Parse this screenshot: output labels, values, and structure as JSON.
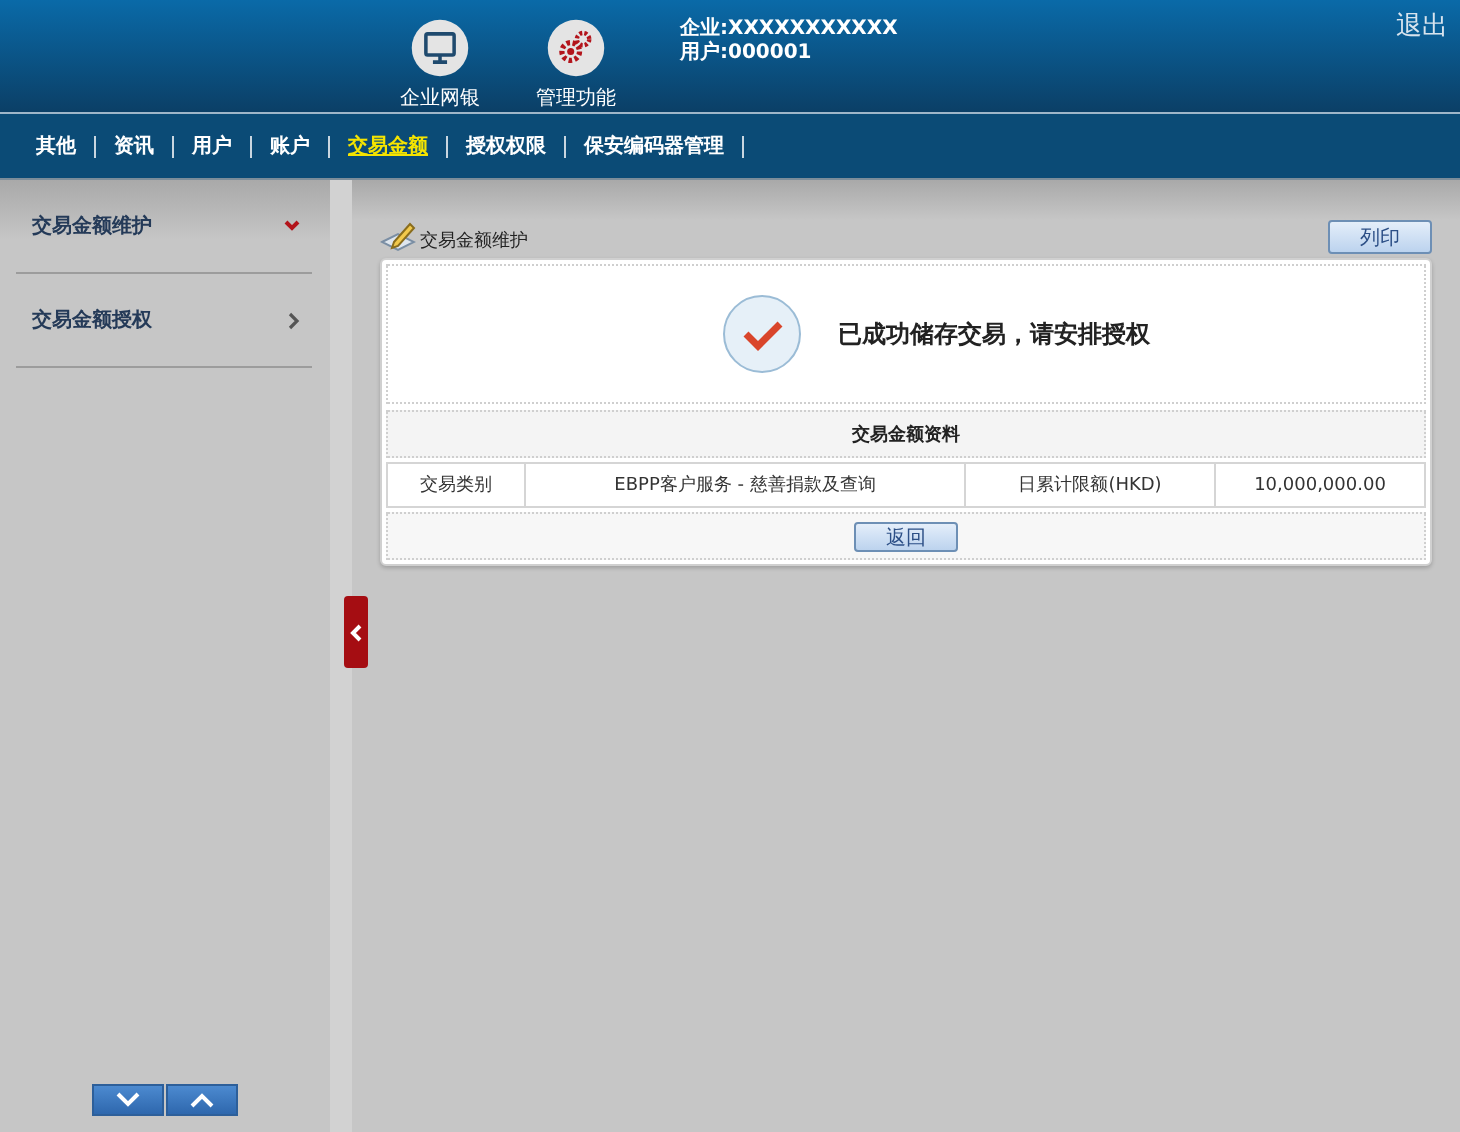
{
  "header": {
    "apps": [
      {
        "kind": "monitor",
        "label": "企业网银"
      },
      {
        "kind": "gears",
        "label": "管理功能"
      }
    ],
    "company": "企业:XXXXXXXXXXX",
    "user": "用户:000001",
    "logout": "退出"
  },
  "nav": {
    "items": [
      {
        "label": "其他",
        "selected": false
      },
      {
        "label": "资讯",
        "selected": false
      },
      {
        "label": "用户",
        "selected": false
      },
      {
        "label": "账户",
        "selected": false
      },
      {
        "label": "交易金额",
        "selected": true
      },
      {
        "label": "授权权限",
        "selected": false
      },
      {
        "label": "保安编码器管理",
        "selected": false
      }
    ]
  },
  "sidebar": {
    "items": [
      {
        "label": "交易金额维护",
        "expanded": true
      },
      {
        "label": "交易金额授权",
        "expanded": false
      }
    ]
  },
  "main": {
    "title": "交易金额维护",
    "print_button": "列印",
    "message": "已成功储存交易，请安排授权",
    "section_title": "交易金额资料",
    "row": [
      "交易类别",
      "EBPP客户服务 - 慈善捐款及查询",
      "日累计限额(HKD)",
      "10,000,000.00"
    ],
    "back_button": "返回"
  }
}
